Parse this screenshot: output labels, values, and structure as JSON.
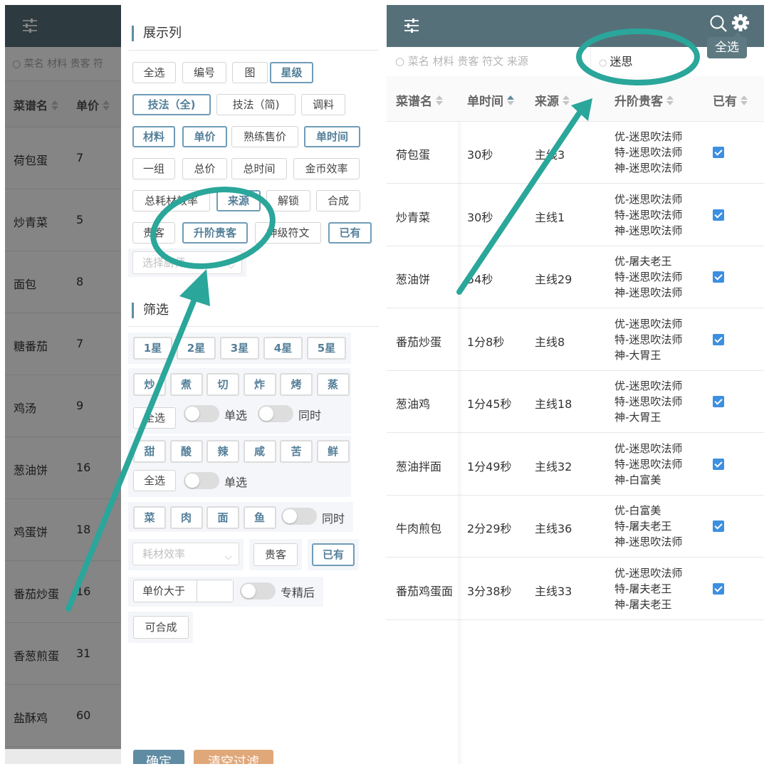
{
  "background_list": {
    "search_placeholder": "菜名 材料 贵客 符",
    "columns": [
      "菜谱名",
      "单价"
    ],
    "rows": [
      {
        "name": "荷包蛋",
        "price": "7"
      },
      {
        "name": "炒青菜",
        "price": "5"
      },
      {
        "name": "面包",
        "price": "8"
      },
      {
        "name": "糖番茄",
        "price": "7"
      },
      {
        "name": "鸡汤",
        "price": "9"
      },
      {
        "name": "葱油饼",
        "price": "16"
      },
      {
        "name": "鸡蛋饼",
        "price": "18"
      },
      {
        "name": "番茄炒蛋",
        "price": "16"
      },
      {
        "name": "香葱煎蛋",
        "price": "31"
      },
      {
        "name": "盐酥鸡",
        "price": "60"
      }
    ]
  },
  "drawer": {
    "display_columns_title": "展示列",
    "display_tags": [
      {
        "label": "全选",
        "on": false
      },
      {
        "label": "编号",
        "on": false
      },
      {
        "label": "图",
        "on": false
      },
      {
        "label": "星级",
        "on": true
      },
      {
        "label": "技法（全)",
        "on": true
      },
      {
        "label": "技法（简)",
        "on": false
      },
      {
        "label": "调料",
        "on": false
      },
      {
        "label": "材料",
        "on": true
      },
      {
        "label": "单价",
        "on": true
      },
      {
        "label": "熟练售价",
        "on": false
      },
      {
        "label": "单时间",
        "on": true
      },
      {
        "label": "一组",
        "on": false
      },
      {
        "label": "总价",
        "on": false
      },
      {
        "label": "总时间",
        "on": false
      },
      {
        "label": "金币效率",
        "on": false
      },
      {
        "label": "总耗材效率",
        "on": false
      },
      {
        "label": "来源",
        "on": true
      },
      {
        "label": "解锁",
        "on": false
      },
      {
        "label": "合成",
        "on": false
      },
      {
        "label": "贵客",
        "on": false
      },
      {
        "label": "升阶贵客",
        "on": true
      },
      {
        "label": "神级符文",
        "on": false
      },
      {
        "label": "已有",
        "on": true
      }
    ],
    "kitchen_placeholder": "选择厨师",
    "filter_title": "筛选",
    "stars": [
      "1星",
      "2星",
      "3星",
      "4星",
      "5星"
    ],
    "skills": [
      "炒",
      "煮",
      "切",
      "炸",
      "烤",
      "蒸"
    ],
    "skills_select_all": "全选",
    "skills_single_label": "单选",
    "skills_same_time_label": "同时",
    "tastes": [
      "甜",
      "酸",
      "辣",
      "咸",
      "苦",
      "鲜"
    ],
    "tastes_select_all": "全选",
    "tastes_single_label": "单选",
    "materials": [
      "菜",
      "肉",
      "面",
      "鱼"
    ],
    "materials_same_time_label": "同时",
    "efficiency_placeholder": "耗材效率",
    "guest_button": "贵客",
    "owned_button": "已有",
    "price_greater_label": "单价大于",
    "price_greater_value": "",
    "after_master_label": "专精后",
    "craftable_button": "可合成",
    "confirm_button": "确定",
    "clear_button": "清空过滤"
  },
  "right_panel": {
    "select_all_tooltip": "全选",
    "search_placeholder": "菜名 材料 贵客 符文 来源",
    "guest_search_value": "迷思",
    "columns": [
      "菜谱名",
      "单时间",
      "来源",
      "升阶贵客",
      "已有"
    ],
    "rows": [
      {
        "name": "荷包蛋",
        "time": "30秒",
        "source": "主线3",
        "guests": [
          "优-迷思吹法师",
          "特-迷思吹法师",
          "神-迷思吹法师"
        ],
        "owned": true
      },
      {
        "name": "炒青菜",
        "time": "30秒",
        "source": "主线1",
        "guests": [
          "优-迷思吹法师",
          "特-迷思吹法师",
          "神-迷思吹法师"
        ],
        "owned": true
      },
      {
        "name": "葱油饼",
        "time": "54秒",
        "source": "主线29",
        "guests": [
          "优-屠夫老王",
          "特-迷思吹法师",
          "神-迷思吹法师"
        ],
        "owned": true
      },
      {
        "name": "番茄炒蛋",
        "time": "1分8秒",
        "source": "主线8",
        "guests": [
          "优-迷思吹法师",
          "特-迷思吹法师",
          "神-大胃王"
        ],
        "owned": true
      },
      {
        "name": "葱油鸡",
        "time": "1分45秒",
        "source": "主线18",
        "guests": [
          "优-迷思吹法师",
          "特-迷思吹法师",
          "神-大胃王"
        ],
        "owned": true
      },
      {
        "name": "葱油拌面",
        "time": "1分49秒",
        "source": "主线32",
        "guests": [
          "优-迷思吹法师",
          "特-迷思吹法师",
          "神-白富美"
        ],
        "owned": true
      },
      {
        "name": "牛肉煎包",
        "time": "2分29秒",
        "source": "主线36",
        "guests": [
          "优-白富美",
          "特-屠夫老王",
          "神-迷思吹法师"
        ],
        "owned": true
      },
      {
        "name": "番茄鸡蛋面",
        "time": "3分38秒",
        "source": "主线33",
        "guests": [
          "优-迷思吹法师",
          "特-屠夫老王",
          "神-屠夫老王"
        ],
        "owned": true
      }
    ]
  },
  "colors": {
    "header_bg": "#56707a",
    "active_tag": "#6f9cb7",
    "confirm_btn": "#5f8ba3",
    "clear_btn": "#e0a778",
    "annotation": "#2aa69a",
    "checkbox": "#3d8fe0"
  },
  "icons": {
    "header_left": "sliders-icon",
    "header_search": "search-icon",
    "header_settings": "gear-icon"
  }
}
